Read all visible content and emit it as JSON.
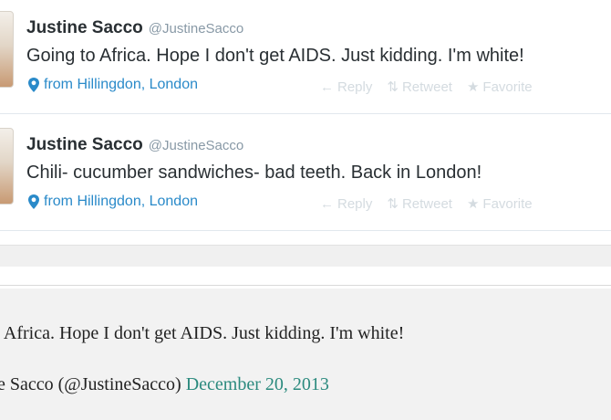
{
  "tweets": [
    {
      "name": "Justine Sacco",
      "handle": "@JustineSacco",
      "text": "Going to Africa. Hope I don't get AIDS. Just kidding. I'm white!",
      "location": "from Hillingdon, London",
      "actions": {
        "reply": "Reply",
        "retweet": "Retweet",
        "favorite": "Favorite"
      }
    },
    {
      "name": "Justine Sacco",
      "handle": "@JustineSacco",
      "text": "Chili- cucumber sandwiches- bad teeth. Back in London!",
      "location": "from Hillingdon, London",
      "actions": {
        "reply": "Reply",
        "retweet": "Retweet",
        "favorite": "Favorite"
      }
    }
  ],
  "embed": {
    "text": "o Africa. Hope I don't get AIDS. Just kidding. I'm white!",
    "attribution": "ne Sacco (@JustineSacco)",
    "date": "December 20, 2013"
  },
  "colors": {
    "link": "#2a8ac9",
    "muted": "#8899a6",
    "action": "#d4dbe0",
    "date_link": "#2b8a7e"
  },
  "icons": {
    "location": "map-pin-icon",
    "reply": "reply-arrow-icon",
    "retweet": "retweet-icon",
    "favorite": "star-icon"
  }
}
